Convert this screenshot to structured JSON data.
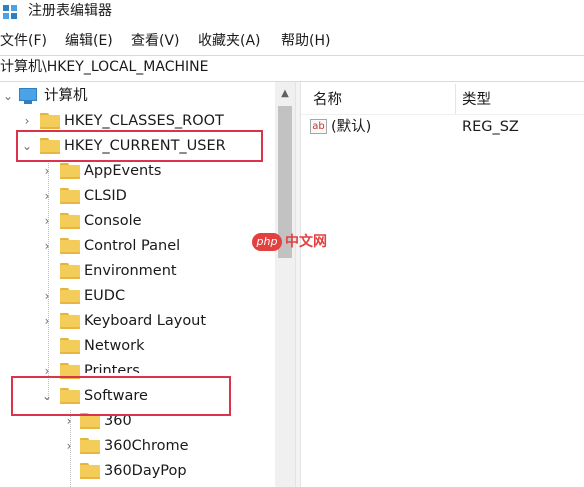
{
  "window": {
    "title": "注册表编辑器"
  },
  "menu": [
    "文件(F)",
    "编辑(E)",
    "查看(V)",
    "收藏夹(A)",
    "帮助(H)"
  ],
  "address": "计算机\\HKEY_LOCAL_MACHINE",
  "tree": {
    "root": "计算机",
    "classes_root": "HKEY_CLASSES_ROOT",
    "current_user": "HKEY_CURRENT_USER",
    "current_user_children": [
      "AppEvents",
      "CLSID",
      "Console",
      "Control Panel",
      "Environment",
      "EUDC",
      "Keyboard Layout",
      "Network",
      "Printers",
      "Software"
    ],
    "software_children": [
      "360",
      "360Chrome",
      "360DayPop"
    ]
  },
  "list": {
    "columns": [
      "名称",
      "类型"
    ],
    "rows": [
      {
        "name": "(默认)",
        "type": "REG_SZ",
        "icon": "ab"
      }
    ]
  },
  "watermark": {
    "badge": "php",
    "text": "中文网"
  },
  "colors": {
    "highlight": "#d9344a",
    "folder": "#f3cc5a",
    "watermark": "#e3403f"
  }
}
